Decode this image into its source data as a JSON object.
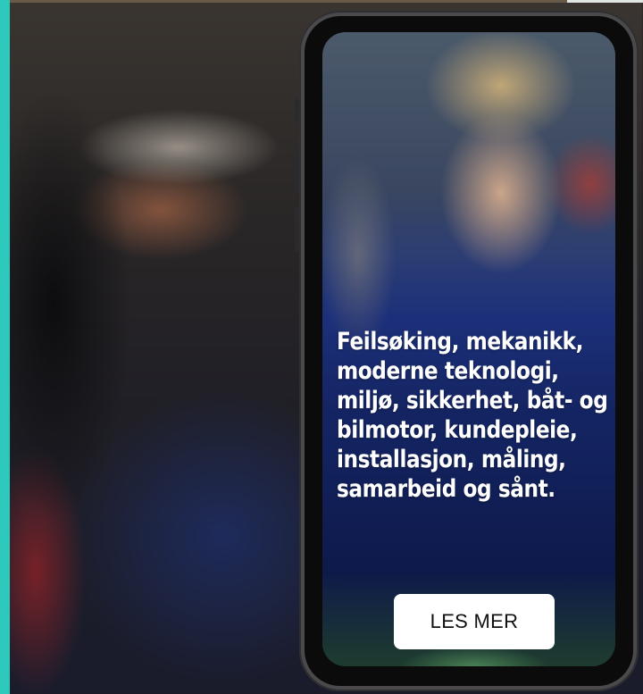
{
  "phone": {
    "headline_lines": [
      "Feilsøking, mekanikk,",
      "moderne teknologi,",
      "miljø, sikkerhet, båt- og",
      "bilmotor, kundepleie,",
      "installasjon,  måling,",
      "samarbeid og sånt."
    ],
    "cta_label": "LES MER"
  },
  "colors": {
    "accent_teal": "#2ec9bd",
    "button_bg": "#ffffff",
    "phone_frame": "#4a4a4c"
  }
}
